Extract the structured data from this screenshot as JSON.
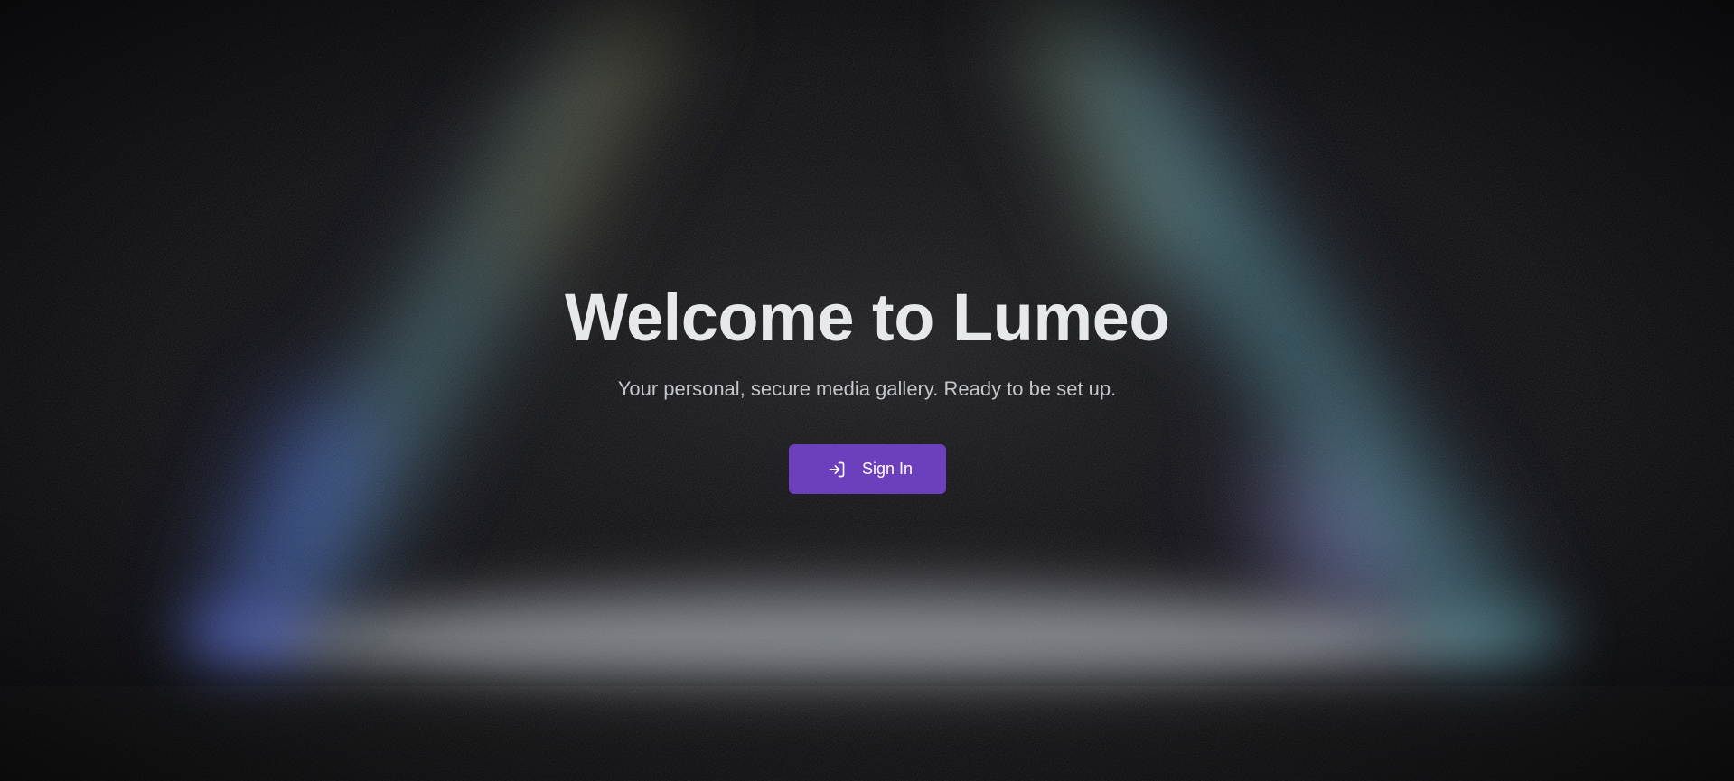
{
  "hero": {
    "title": "Welcome to Lumeo",
    "subtitle": "Your personal, secure media gallery. Ready to be set up.",
    "signin_label": "Sign In",
    "signin_icon": "sign-in-icon"
  },
  "colors": {
    "background": "#07060b",
    "accent": "#6c3fbd",
    "title_text": "#e6e8ec",
    "subtitle_text": "#c3c6cc"
  }
}
